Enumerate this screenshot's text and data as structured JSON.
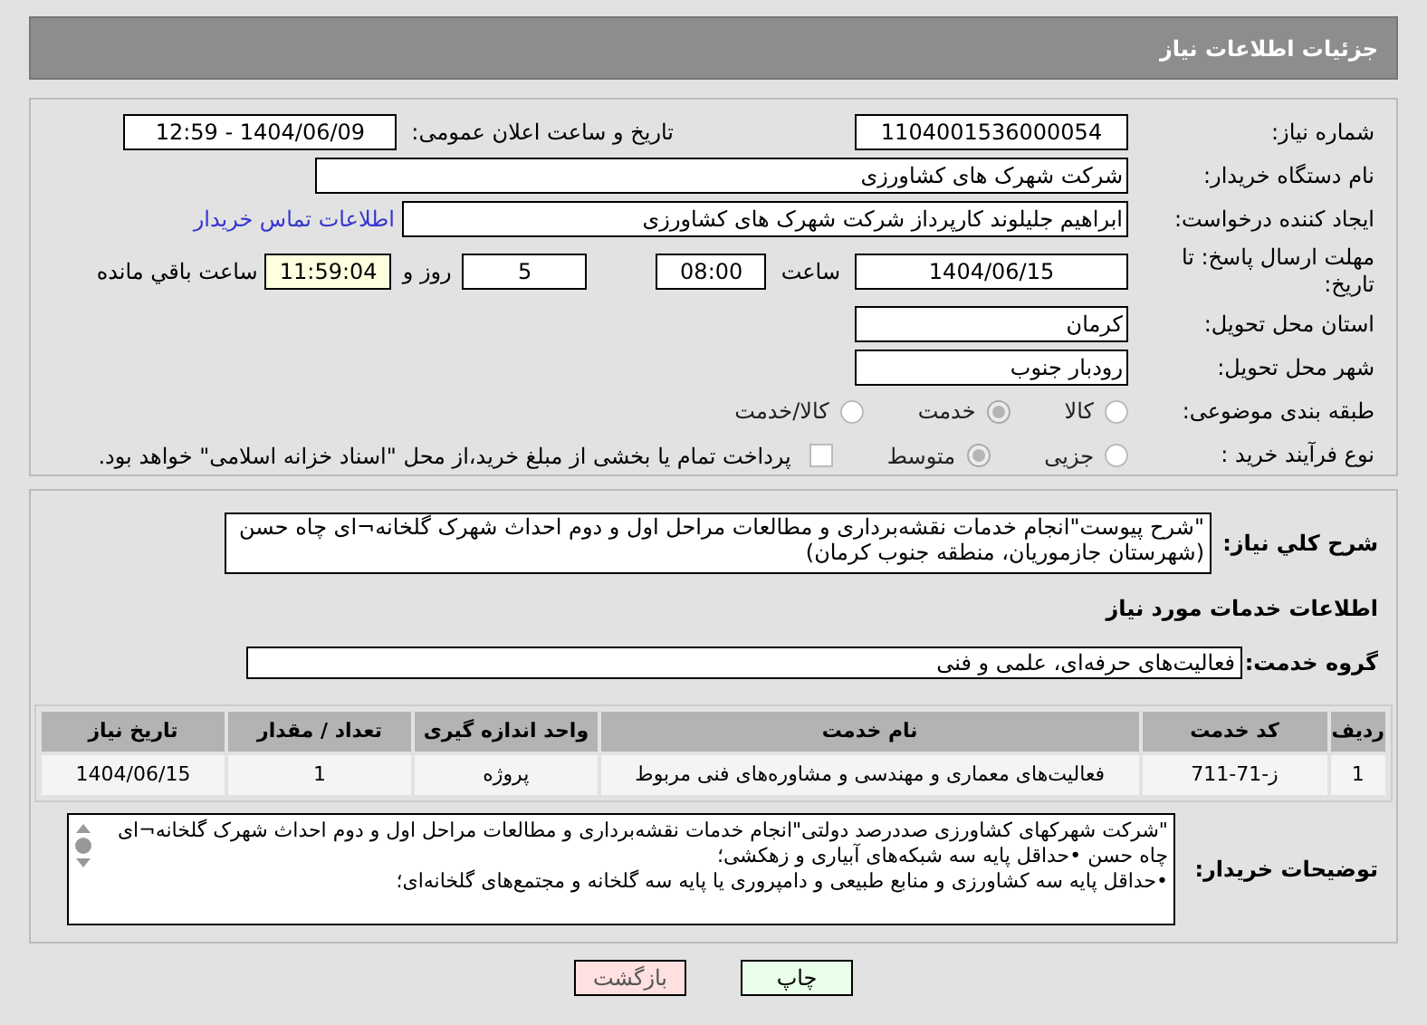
{
  "header": {
    "title": "جزئیات اطلاعات نیاز"
  },
  "details": {
    "need_number": {
      "label": "شماره نیاز:",
      "value": "1104001536000054"
    },
    "announce": {
      "label": "تاریخ و ساعت اعلان عمومی:",
      "value": "1404/06/09 - 12:59"
    },
    "buyer": {
      "label": "نام دستگاه خریدار:",
      "value": "شرکت شهرک های کشاورزی"
    },
    "creator": {
      "label": "ایجاد کننده درخواست:",
      "value": "ابراهیم جلیلوند کارپرداز شرکت شهرک های کشاورزی",
      "link": "اطلاعات تماس خریدار"
    },
    "deadline": {
      "label": "مهلت ارسال پاسخ: تا تاریخ:",
      "date": "1404/06/15",
      "time_label": "ساعت",
      "time": "08:00",
      "days": "5",
      "days_label": "روز و",
      "remaining": "11:59:04",
      "remaining_label": "ساعت باقي مانده"
    },
    "province": {
      "label": "استان محل تحویل:",
      "value": "کرمان"
    },
    "city": {
      "label": "شهر محل تحویل:",
      "value": "رودبار جنوب"
    },
    "category": {
      "label": "طبقه بندی موضوعی:",
      "options": [
        {
          "label": "کالا",
          "selected": false
        },
        {
          "label": "خدمت",
          "selected": true
        },
        {
          "label": "کالا/خدمت",
          "selected": false
        }
      ]
    },
    "process": {
      "label": "نوع فرآیند خرید :",
      "options": [
        {
          "label": "جزیی",
          "selected": false
        },
        {
          "label": "متوسط",
          "selected": true
        }
      ],
      "treasury": {
        "checked": false,
        "text": "پرداخت تمام یا بخشی از مبلغ خرید،از محل \"اسناد خزانه اسلامی\" خواهد بود."
      }
    }
  },
  "description": {
    "label": "شرح کلي نياز:",
    "text": "\"شرح پیوست\"انجام خدمات نقشه‌برداری و مطالعات مراحل اول و دوم احداث شهرک گلخانه¬ای چاه حسن (شهرستان جازموریان، منطقه جنوب کرمان)"
  },
  "services_title": "اطلاعات خدمات مورد نیاز",
  "service_group": {
    "label": "گروه خدمت:",
    "value": "فعالیت‌های حرفه‌ای، علمی و فنی"
  },
  "table": {
    "columns": [
      "ردیف",
      "کد خدمت",
      "نام خدمت",
      "واحد اندازه گیری",
      "تعداد / مقدار",
      "تاریخ نیاز"
    ],
    "rows": [
      [
        "1",
        "ز-71-711",
        "فعالیت‌های معماری و مهندسی و مشاوره‌های فنی مربوط",
        "پروژه",
        "1",
        "1404/06/15"
      ]
    ]
  },
  "buyer_notes": {
    "label": "توضیحات خریدار:",
    "paragraphs": [
      "\"شرکت شهرکهای کشاورزی صددرصد دولتی\"انجام خدمات نقشه‌برداری و مطالعات مراحل اول و دوم احداث شهرک گلخانه¬ای چاه حسن •حداقل پایه سه شبکه‌های آبیاری و زهکشی؛",
      "•حداقل پایه سه کشاورزی و منابع طبیعی و دامپروری یا پایه سه گلخانه و مجتمع‌های گلخانه‌ای؛"
    ]
  },
  "buttons": [
    {
      "label": "چاپ",
      "kind": "print"
    },
    {
      "label": "بازگشت",
      "kind": "back"
    }
  ]
}
